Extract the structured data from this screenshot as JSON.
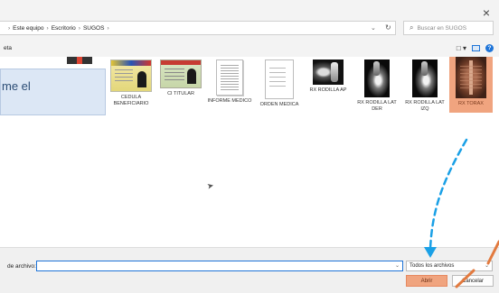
{
  "window": {
    "close_label": "×"
  },
  "address": {
    "crumbs": [
      "Este equipo",
      "Escritorio",
      "SUGOS"
    ],
    "separator": "›",
    "search_placeholder": "Buscar en SUGOS"
  },
  "toolbar": {
    "left_partial": "eta"
  },
  "tooltip": {
    "text": "me el"
  },
  "files": [
    {
      "label": "CEDULA BENEFICIARIO",
      "kind": "cedula"
    },
    {
      "label": "CI TITULAR",
      "kind": "ci"
    },
    {
      "label": "INFORME MEDICO",
      "kind": "doc"
    },
    {
      "label": "ORDEN MEDICA",
      "kind": "doc2"
    },
    {
      "label": "RX RODILLA AP",
      "kind": "xray-ap"
    },
    {
      "label": "RX RODILLA LAT DER",
      "kind": "xray-lat"
    },
    {
      "label": "RX RODILLA LAT IZQ",
      "kind": "xray-lat"
    },
    {
      "label": "RX TORAX",
      "kind": "xray-thorax",
      "selected": true
    }
  ],
  "footer": {
    "filename_label": "de archivo:",
    "filename_value": "",
    "filetype_value": "Todos los archivos",
    "open_label": "Abrir",
    "cancel_label": "Cancelar"
  },
  "colors": {
    "accent": "#1e74d8",
    "highlight": "#f0a47f",
    "annotation_blue": "#1aa0e6",
    "annotation_orange": "#e27a3f"
  }
}
